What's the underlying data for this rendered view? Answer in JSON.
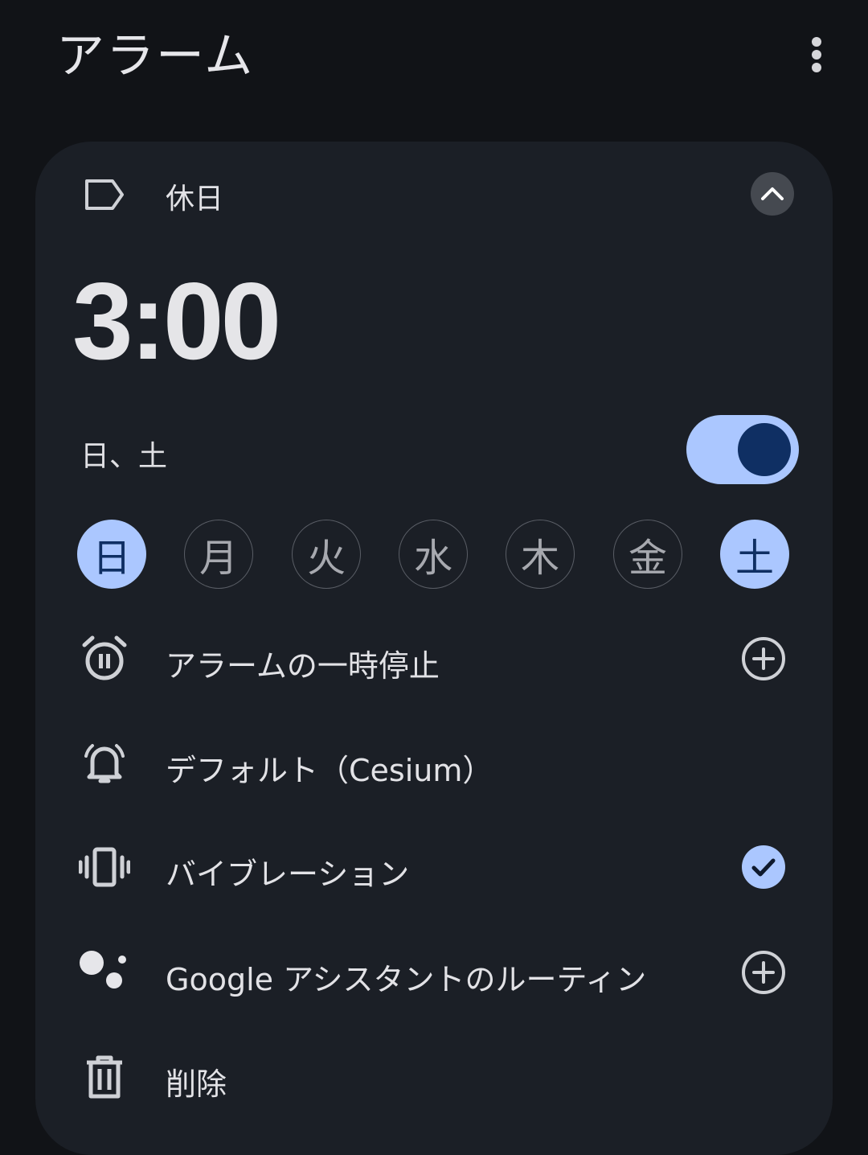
{
  "header": {
    "title": "アラーム",
    "menu_icon": "more-vert-icon"
  },
  "alarm": {
    "label": "休日",
    "time": "3:00",
    "days_summary": "日、土",
    "enabled": true,
    "days": [
      {
        "label": "日",
        "selected": true
      },
      {
        "label": "月",
        "selected": false
      },
      {
        "label": "火",
        "selected": false
      },
      {
        "label": "水",
        "selected": false
      },
      {
        "label": "木",
        "selected": false
      },
      {
        "label": "金",
        "selected": false
      },
      {
        "label": "土",
        "selected": true
      }
    ],
    "options": {
      "pause": {
        "label": "アラームの一時停止",
        "icon": "alarm-pause-icon",
        "action_icon": "add-circle-icon"
      },
      "sound": {
        "label": "デフォルト（Cesium）",
        "icon": "bell-icon"
      },
      "vibration": {
        "label": "バイブレーション",
        "icon": "vibration-icon",
        "checked": true,
        "action_icon": "check-circle-icon"
      },
      "assistant": {
        "label": "Google アシスタントのルーティン",
        "icon": "google-assistant-icon",
        "action_icon": "add-circle-icon"
      },
      "delete": {
        "label": "削除",
        "icon": "trash-icon"
      }
    }
  },
  "colors": {
    "background": "#111317",
    "card": "#1b1f26",
    "accent": "#abc7ff",
    "accent_dark": "#0f2f63"
  }
}
